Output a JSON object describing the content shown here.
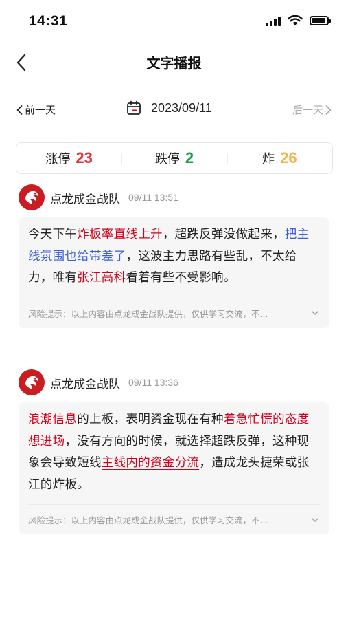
{
  "status_bar": {
    "time": "14:31"
  },
  "nav": {
    "title": "文字播报"
  },
  "date_bar": {
    "prev_label": "前一天",
    "date": "2023/09/11",
    "next_label": "后一天"
  },
  "stats": [
    {
      "label": "涨停",
      "value": "23",
      "color": "#e8303a"
    },
    {
      "label": "跌停",
      "value": "2",
      "color": "#1f9d4a"
    },
    {
      "label": "炸",
      "value": "26",
      "color": "#f5b24a"
    }
  ],
  "posts": [
    {
      "author": "点龙成金战队",
      "time": "09/11 13:51",
      "segments": [
        {
          "text": "今天下午",
          "style": "plain"
        },
        {
          "text": "炸板率直线上升",
          "style": "red-underline"
        },
        {
          "text": "，超跌反弹没做起来，",
          "style": "plain"
        },
        {
          "text": "把主线氛围也给带差了",
          "style": "blue-underline"
        },
        {
          "text": "，这波主力思路有些乱，不太给力，唯有",
          "style": "plain"
        },
        {
          "text": "张江高科",
          "style": "red"
        },
        {
          "text": "看着有些不受影响。",
          "style": "plain"
        }
      ],
      "risk": "风险提示：以上内容由点龙成金战队提供，仅供学习交流，不..."
    },
    {
      "author": "点龙成金战队",
      "time": "09/11 13:36",
      "segments": [
        {
          "text": "浪潮信息",
          "style": "red"
        },
        {
          "text": "的上板，表明资金现在有种",
          "style": "plain"
        },
        {
          "text": "着急忙慌的态度想进场",
          "style": "red-underline"
        },
        {
          "text": "，没有方向的时候，就选择超跌反弹，这种现象会导致短线",
          "style": "plain"
        },
        {
          "text": "主线内的资金分流",
          "style": "red-underline"
        },
        {
          "text": "，造成龙头捷荣或张江的炸板。",
          "style": "plain"
        }
      ],
      "risk": "风险提示：以上内容由点龙成金战队提供，仅供学习交流，不..."
    }
  ]
}
